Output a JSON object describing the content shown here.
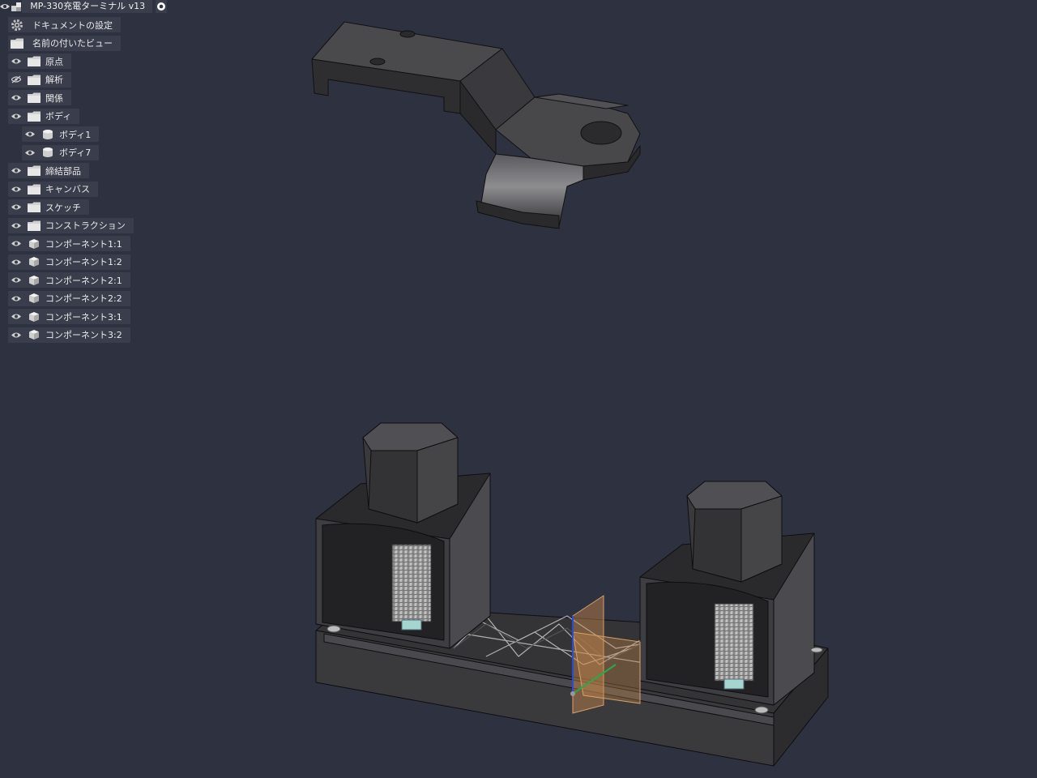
{
  "document": {
    "title": "MP-330充電ターミナル v13"
  },
  "browser": {
    "items": [
      {
        "label": "ドキュメントの設定",
        "icon": "gear-icon",
        "eye": "none",
        "indent": 0
      },
      {
        "label": "名前の付いたビュー",
        "icon": "folder-icon",
        "eye": "none",
        "indent": 0
      },
      {
        "label": "原点",
        "icon": "folder-icon",
        "eye": "visible",
        "indent": 0
      },
      {
        "label": "解析",
        "icon": "folder-icon",
        "eye": "hidden",
        "indent": 0
      },
      {
        "label": "関係",
        "icon": "folder-icon",
        "eye": "visible",
        "indent": 0
      },
      {
        "label": "ボディ",
        "icon": "folder-icon",
        "eye": "visible",
        "indent": 0
      },
      {
        "label": "ボディ1",
        "icon": "body-icon",
        "eye": "visible",
        "indent": 1
      },
      {
        "label": "ボディ7",
        "icon": "body-icon",
        "eye": "visible",
        "indent": 1
      },
      {
        "label": "締結部品",
        "icon": "folder-icon",
        "eye": "visible",
        "indent": 0
      },
      {
        "label": "キャンバス",
        "icon": "folder-icon",
        "eye": "visible",
        "indent": 0
      },
      {
        "label": "スケッチ",
        "icon": "folder-icon",
        "eye": "visible",
        "indent": 0
      },
      {
        "label": "コンストラクション",
        "icon": "folder-icon",
        "eye": "visible",
        "indent": 0
      },
      {
        "label": "コンポーネント1:1",
        "icon": "component-icon",
        "eye": "visible",
        "indent": 0
      },
      {
        "label": "コンポーネント1:2",
        "icon": "component-icon",
        "eye": "visible",
        "indent": 0
      },
      {
        "label": "コンポーネント2:1",
        "icon": "component-icon",
        "eye": "visible",
        "indent": 0
      },
      {
        "label": "コンポーネント2:2",
        "icon": "component-icon",
        "eye": "visible",
        "indent": 0
      },
      {
        "label": "コンポーネント3:1",
        "icon": "component-icon",
        "eye": "visible",
        "indent": 0
      },
      {
        "label": "コンポーネント3:2",
        "icon": "component-icon",
        "eye": "visible",
        "indent": 0
      }
    ]
  },
  "colors": {
    "background": "#2e3140",
    "panel": "#3a3d4c",
    "model": "#3b3b3e"
  }
}
